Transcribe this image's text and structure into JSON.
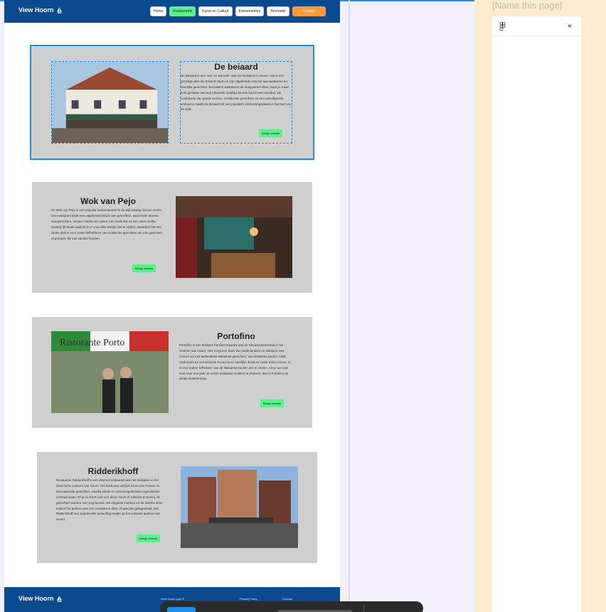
{
  "site": {
    "brand": "View Hoorn",
    "nav": [
      "Home",
      "Restaurants",
      "Kunst en Cultuur",
      "Evenementen",
      "Recreatie",
      "Contact"
    ],
    "active_nav": "Restaurants"
  },
  "restaurants": [
    {
      "name": "De beiaard",
      "description": "De Beiaard is een \"eet- en biercafé\" aan het Kerkplein in Hoorn. Het is een gezellige plek die bekend staat om zijn uitgebreide selectie speciaalbieren en heerlijke gerechten. Bezoekers waarderen de ontspannen sfeer, waar je zowel kunt genieten van een informele maaltijd als een borrel met vrienden. De combinatie van goede service, smaakvolle gerechten en een uitnodigende ambiance maakt De Beiaard tot een populaire ontmoetingsplaats in het hart van de stad.",
      "button": "Bekijk website"
    },
    {
      "name": "Wok van Pejo",
      "description": "De Wok van Pejo is een populair wokrestaurant in de wijk Zwaag, binnen Hoorn. Het restaurant biedt een uitgebreide keuze aan gerechten, waaronder diverse voorgerechten, soepen, barbecue-opties, een sushi-bar en een warm buffet. Dankzij dit brede aanbod is er voor elke smaak iets te vinden, waardoor het een ideale plek is voor zowel liefhebbers van Aziatische gerechten als voor gezinnen of groepen die van variatie houden.",
      "button": "Bekijk website"
    },
    {
      "name": "Portofino",
      "description": "Portofino is een Italiaans familierestaurant aan de Nieuwendamstraat in het centrum van Hoorn. Hier zorgt een team van Nederlanders en Italianen voor menu's vol met authentieke Italiaanse gerechten. Van klassieke pasta's zoals Carbonara tot verrassende Focaccia en heerlijke desserts zoals Torta Limone, er is voor iedere liefhebber van de Italiaanse keuken iets te vinden. Als je op zoek bent naar een plek om echte Italiaanse smaken te proeven, dan is Portofino de ideale bestemming!",
      "button": "Bekijk website"
    },
    {
      "name": "Ridderikhoff",
      "description": "Restaurant Ridderikhoff is een sfeervol restaurant aan het Kerkplein in het historische centrum van Hoorn. Het biedt een verfijnd menu met Franse en internationale gerechten, waarbij lokale en seizoensgebonden ingrediënten centraal staan. Of je nu komt voor een diner, lunch of culinaire proeverij, de gerechten worden met zorg bereid. Het elegante interieur en de intieme sfeer maken het perfect voor een romantisch diner of speciale gelegenheid, wat Ridderikhoff een waardevolle aanvulling maakt op het culinaire aanbod van Hoorn.",
      "button": "Bekijk website"
    }
  ],
  "footer": {
    "brand": "View Hoorn",
    "col1": "View Hoorn plus ®",
    "col2": "Privacy Policy",
    "col3": "Contact"
  },
  "editor": {
    "page_name": "[Name this page]"
  },
  "colors": {
    "header": "#0b4a8f",
    "accent": "#5cf08a",
    "contact": "#ff9a3d",
    "selection": "#1c8fe8"
  }
}
